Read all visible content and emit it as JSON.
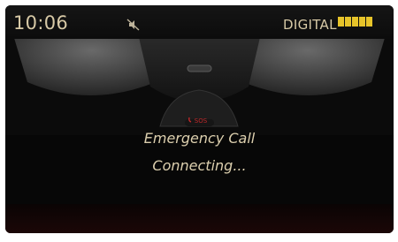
{
  "status_bar": {
    "time": "10:06",
    "mute_icon": "speaker-muted-icon",
    "radio_mode": "DIGITAL",
    "signal_icon": "signal-strength-icon"
  },
  "overhead": {
    "button_label": "SOS",
    "sos_color": "#c0282a"
  },
  "message": {
    "title": "Emergency Call",
    "status": "Connecting..."
  },
  "colors": {
    "text": "#dccfae",
    "signal": "#e7c42a",
    "background": "#070707"
  }
}
